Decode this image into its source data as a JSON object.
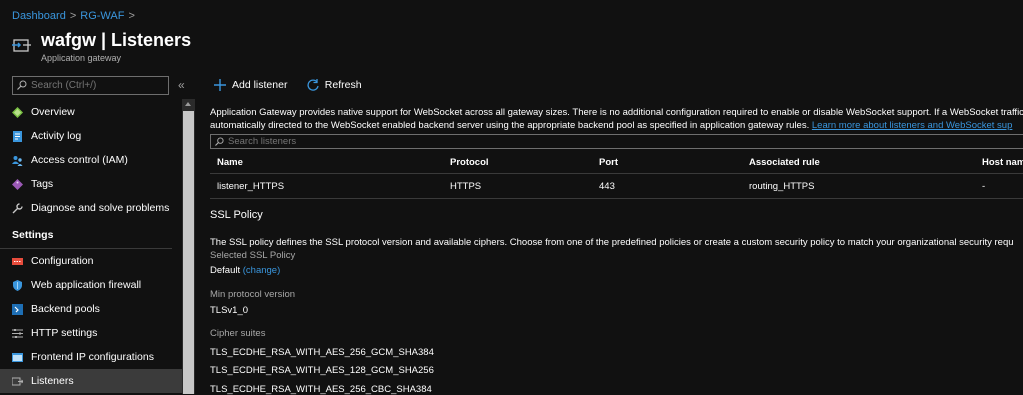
{
  "breadcrumb": {
    "items": [
      "Dashboard",
      "RG-WAF"
    ],
    "separator": ">"
  },
  "header": {
    "title": "wafgw | Listeners",
    "subtitle": "Application gateway"
  },
  "sidebar": {
    "search_placeholder": "Search (Ctrl+/)",
    "collapse_glyph": "«",
    "items": [
      {
        "label": "Overview",
        "icon": "overview-icon"
      },
      {
        "label": "Activity log",
        "icon": "activity-log-icon"
      },
      {
        "label": "Access control (IAM)",
        "icon": "iam-icon"
      },
      {
        "label": "Tags",
        "icon": "tag-icon"
      },
      {
        "label": "Diagnose and solve problems",
        "icon": "wrench-icon"
      }
    ],
    "settings_header": "Settings",
    "settings_items": [
      {
        "label": "Configuration",
        "icon": "configuration-icon"
      },
      {
        "label": "Web application firewall",
        "icon": "shield-icon"
      },
      {
        "label": "Backend pools",
        "icon": "backend-pools-icon"
      },
      {
        "label": "HTTP settings",
        "icon": "settings-list-icon"
      },
      {
        "label": "Frontend IP configurations",
        "icon": "frontend-ip-icon"
      },
      {
        "label": "Listeners",
        "icon": "listeners-icon",
        "active": true
      }
    ]
  },
  "toolbar": {
    "add_label": "Add listener",
    "refresh_label": "Refresh"
  },
  "info": {
    "line1": "Application Gateway provides native support for WebSocket across all gateway sizes. There is no additional configuration required to enable or disable WebSocket support. If a WebSocket traffic",
    "line2": "automatically directed to the WebSocket enabled backend server using the appropriate backend pool as specified in application gateway rules.",
    "link": "Learn more about listeners and WebSocket sup"
  },
  "filter_placeholder": "Search listeners",
  "table": {
    "columns": [
      "Name",
      "Protocol",
      "Port",
      "Associated rule",
      "Host nam"
    ],
    "rows": [
      [
        "listener_HTTPS",
        "HTTPS",
        "443",
        "routing_HTTPS",
        "-"
      ]
    ]
  },
  "ssl": {
    "title": "SSL Policy",
    "description": "The SSL policy defines the SSL protocol version and available ciphers. Choose from one of the predefined policies or create a custom security policy to match your organizational security requ",
    "selected_label": "Selected SSL Policy",
    "selected_value": "Default",
    "change_link": "(change)",
    "min_protocol_label": "Min protocol version",
    "min_protocol_value": "TLSv1_0",
    "cipher_label": "Cipher suites",
    "ciphers": [
      "TLS_ECDHE_RSA_WITH_AES_256_GCM_SHA384",
      "TLS_ECDHE_RSA_WITH_AES_128_GCM_SHA256",
      "TLS_ECDHE_RSA_WITH_AES_256_CBC_SHA384"
    ]
  },
  "colors": {
    "background": "#111111",
    "accent": "#3a96dd",
    "active_nav": "#3b3b3b",
    "border": "#3a3a3a"
  }
}
